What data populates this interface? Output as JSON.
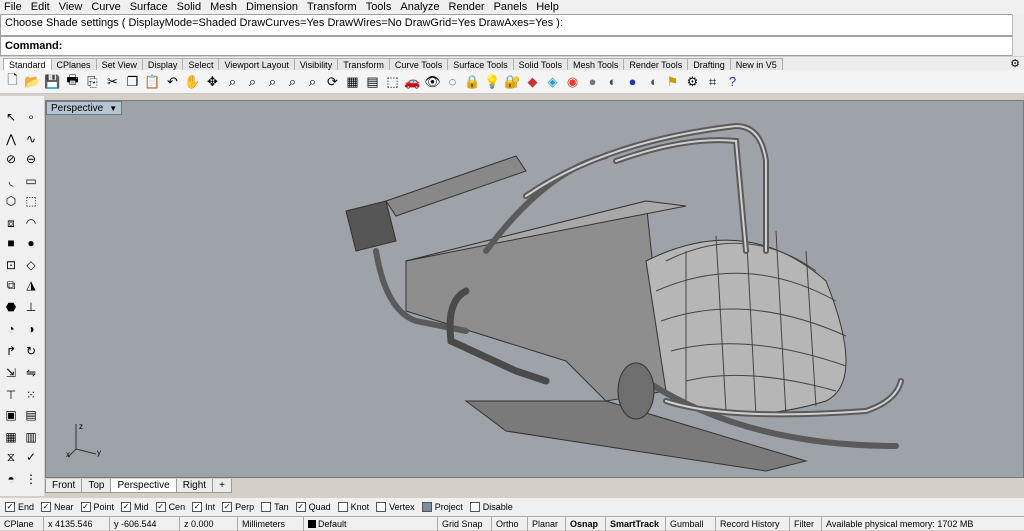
{
  "menu": [
    "File",
    "Edit",
    "View",
    "Curve",
    "Surface",
    "Solid",
    "Mesh",
    "Dimension",
    "Transform",
    "Tools",
    "Analyze",
    "Render",
    "Panels",
    "Help"
  ],
  "command": {
    "history": "Choose Shade settings ( DisplayMode=Shaded  DrawCurves=Yes  DrawWires=No  DrawGrid=Yes  DrawAxes=Yes ):",
    "prompt": "Command:"
  },
  "toolbar_tabs": [
    "Standard",
    "CPlanes",
    "Set View",
    "Display",
    "Select",
    "Viewport Layout",
    "Visibility",
    "Transform",
    "Curve Tools",
    "Surface Tools",
    "Solid Tools",
    "Mesh Tools",
    "Render Tools",
    "Drafting",
    "New in V5"
  ],
  "viewport": {
    "title": "Perspective",
    "axis_x": "x",
    "axis_y": "y",
    "axis_z": "z",
    "bg": "#9ea3a9"
  },
  "view_tabs": [
    "Front",
    "Top",
    "Perspective",
    "Right",
    "+"
  ],
  "osnaps": [
    {
      "label": "End",
      "checked": true
    },
    {
      "label": "Near",
      "checked": true
    },
    {
      "label": "Point",
      "checked": true
    },
    {
      "label": "Mid",
      "checked": true
    },
    {
      "label": "Cen",
      "checked": true
    },
    {
      "label": "Int",
      "checked": true
    },
    {
      "label": "Perp",
      "checked": true
    },
    {
      "label": "Tan",
      "checked": false
    },
    {
      "label": "Quad",
      "checked": true
    },
    {
      "label": "Knot",
      "checked": false
    },
    {
      "label": "Vertex",
      "checked": false
    },
    {
      "label": "Project",
      "checked": false
    },
    {
      "label": "Disable",
      "checked": false
    }
  ],
  "status": {
    "cplane": "CPlane",
    "x": "x 4135.546",
    "y": "y -606.544",
    "z": "z 0.000",
    "units": "Millimeters",
    "layer": "Default",
    "grid_snap": "Grid Snap",
    "ortho": "Ortho",
    "planar": "Planar",
    "osnap": "Osnap",
    "smarttrack": "SmartTrack",
    "gumball": "Gumball",
    "record": "Record History",
    "filter": "Filter",
    "memory": "Available physical memory: 1702 MB"
  }
}
